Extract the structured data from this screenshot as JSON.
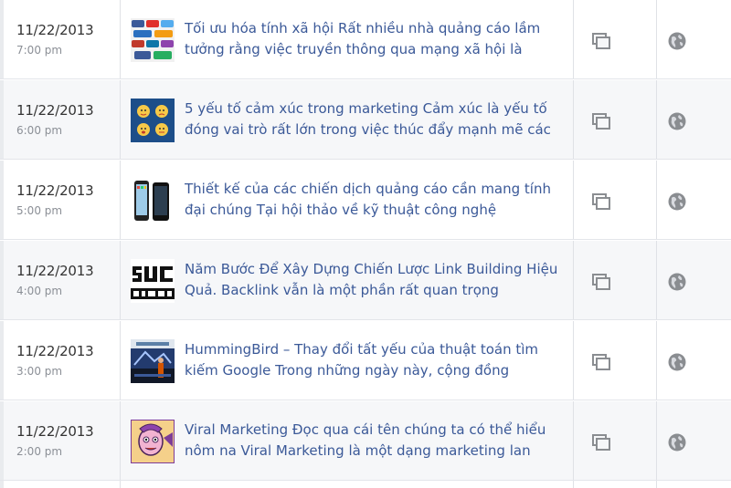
{
  "icons": {
    "post_type": "stacked-pages-icon",
    "audience": "globe-icon"
  },
  "colors": {
    "link": "#3b5998",
    "date": "#333333",
    "time": "#8b8f96",
    "icon": "#8a8d91",
    "row_alt": "#f6f7f9"
  },
  "posts": [
    {
      "date": "11/22/2013",
      "time": "7:00 pm",
      "title": "Tối ưu hóa tính xã hội Rất nhiều nhà quảng cáo lầm tưởng rằng việc truyền thông qua mạng xã hội là",
      "thumbnail": "social-media-logos-collage"
    },
    {
      "date": "11/22/2013",
      "time": "6:00 pm",
      "title": "5 yếu tố cảm xúc trong marketing Cảm xúc là yếu tố đóng vai trò rất lớn trong việc thúc đẩy mạnh mẽ các",
      "thumbnail": "emotion-faces"
    },
    {
      "date": "11/22/2013",
      "time": "5:00 pm",
      "title": "Thiết kế của các chiến dịch quảng cáo cần mang tính đại chúng Tại hội thảo về kỹ thuật công nghệ",
      "thumbnail": "smartphones"
    },
    {
      "date": "11/22/2013",
      "time": "4:00 pm",
      "title": "Năm Bước Để Xây Dựng Chiến Lược Link Building Hiệu Quả. Backlink vẫn là một phần rất quan trọng",
      "thumbnail": "link-building-text"
    },
    {
      "date": "11/22/2013",
      "time": "3:00 pm",
      "title": "HummingBird – Thay đổi tất yếu của thuật toán tìm kiếm Google Trong những ngày này, cộng đồng",
      "thumbnail": "hummingbird-conference"
    },
    {
      "date": "11/22/2013",
      "time": "2:00 pm",
      "title": "Viral Marketing Đọc qua cái tên chúng ta có thể hiểu nôm na Viral Marketing là một dạng marketing lan",
      "thumbnail": "cartoon-character"
    }
  ]
}
